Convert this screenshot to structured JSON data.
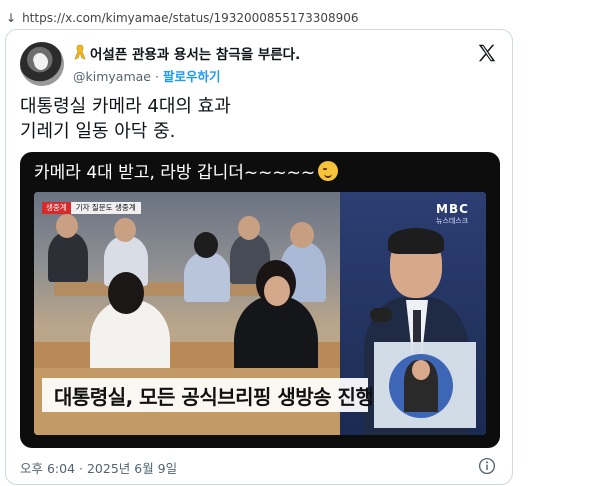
{
  "browser": {
    "download_glyph": "↓",
    "url": "https://x.com/kimyamae/status/1932000855173308906"
  },
  "tweet": {
    "display_name": "어설픈 관용과 용서는 참극을 부른다.",
    "handle": "@kimyamae",
    "separator": "·",
    "follow_label": "팔로우하기",
    "text_lines": [
      "대통령실 카메라 4대의 효과",
      "기레기 일동 아닥 중."
    ],
    "timestamp": "오후 6:04 · 2025년 6월 9일"
  },
  "media": {
    "caption": "카메라 4대 받고, 라방 갑니더~~~~~",
    "live_tag": "생중계",
    "live_tag_sub": "기자 질문도 생중계",
    "broadcaster": "MBC",
    "broadcaster_sub": "뉴스데스크",
    "subtitle": "대통령실, 모든 공식브리핑 생방송 진행"
  },
  "icons": {
    "ribbon": "yellow-ribbon-icon",
    "x_logo": "x-logo-icon",
    "info": "info-icon",
    "emoji": "winking-face-emoji"
  },
  "colors": {
    "accent": "#1d9bf0",
    "muted_text": "#536471",
    "border": "#cfd9de"
  }
}
